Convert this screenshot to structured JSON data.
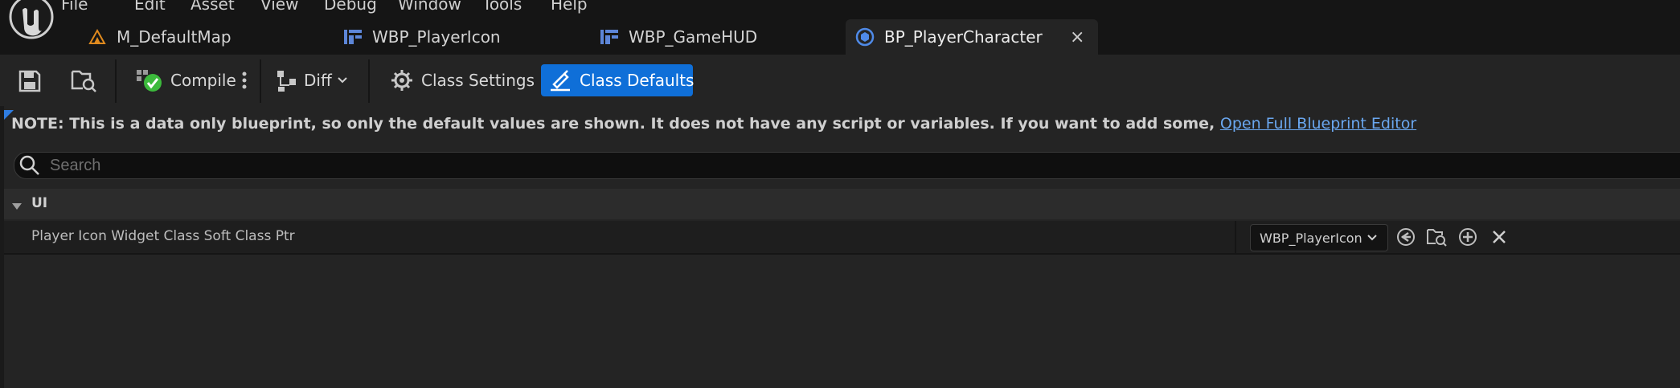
{
  "menu": [
    "File",
    "Edit",
    "Asset",
    "View",
    "Debug",
    "Window",
    "Tools",
    "Help"
  ],
  "tabs": [
    {
      "label": "M_DefaultMap",
      "icon": "material-icon"
    },
    {
      "label": "WBP_PlayerIcon",
      "icon": "widget-blueprint-icon"
    },
    {
      "label": "WBP_GameHUD",
      "icon": "widget-blueprint-icon"
    },
    {
      "label": "BP_PlayerCharacter",
      "icon": "blueprint-icon",
      "active": true,
      "close": "×"
    }
  ],
  "toolbar": {
    "compile_label": "Compile",
    "diff_label": "Diff",
    "class_settings_label": "Class Settings",
    "class_defaults_label": "Class Defaults"
  },
  "panel": {
    "note": "NOTE: This is a data only blueprint, so only the default values are shown.  It does not have any script or variables.  If you want to add some, ",
    "note_link": "Open Full Blueprint Editor",
    "search_placeholder": "Search",
    "category": "UI",
    "property": {
      "label": "Player Icon Widget Class Soft Class Ptr",
      "value": "WBP_PlayerIcon"
    }
  },
  "colors": {
    "accent": "#0f6fd8",
    "link": "#6aa7ef",
    "compile_ok": "#3cba3c",
    "material_icon": "#e08a1e"
  }
}
